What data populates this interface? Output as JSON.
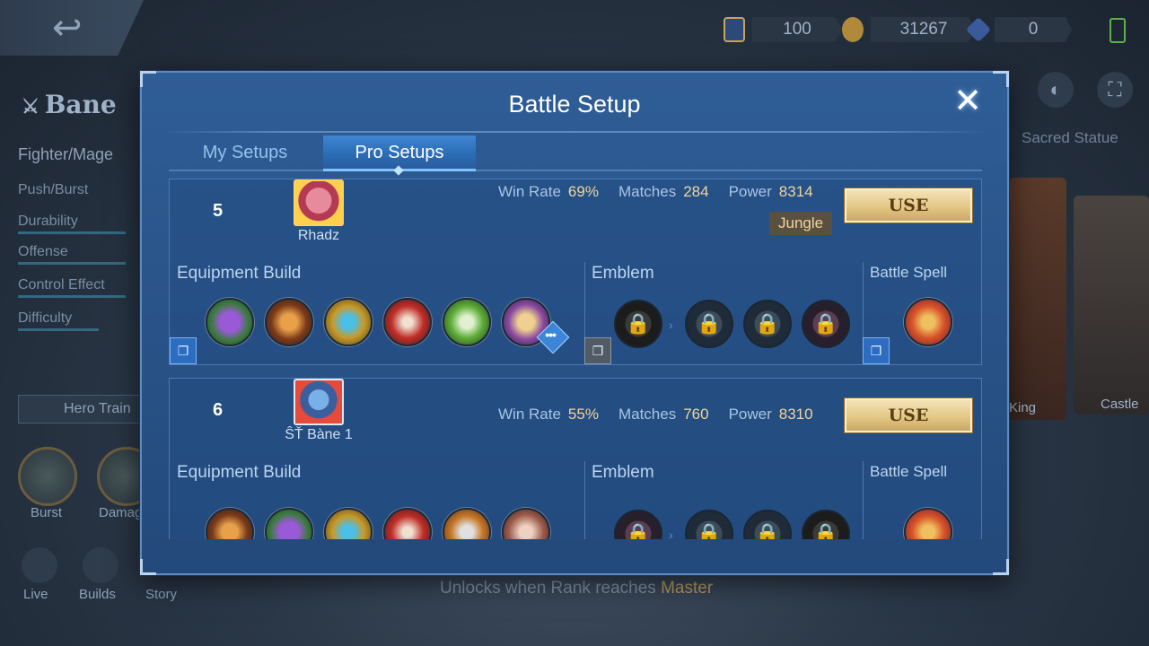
{
  "background": {
    "hero_name": "Bane",
    "role": "Fighter/Mage",
    "stats": [
      "Push/Burst",
      "Durability",
      "Offense",
      "Control Effect",
      "Difficulty"
    ],
    "hero_training": "Hero Train",
    "circles": [
      "Burst",
      "Damag"
    ],
    "nav": [
      "Live",
      "Builds",
      "Story"
    ],
    "sacred_statue": "Sacred Statue",
    "card_labels": [
      "King",
      "Castle"
    ],
    "unlock_text": "Unlocks when Rank reaches",
    "unlock_rank": "Master",
    "currency": {
      "tickets": "100",
      "gold": "31267",
      "diamonds": "0",
      "plus": "+"
    }
  },
  "modal": {
    "title": "Battle Setup",
    "close": "✕",
    "tabs": {
      "my": "My Setups",
      "pro": "Pro Setups"
    },
    "labels": {
      "win_rate": "Win Rate",
      "matches": "Matches",
      "power": "Power",
      "equipment": "Equipment Build",
      "emblem": "Emblem",
      "spell": "Battle Spell",
      "use": "USE"
    },
    "setups": [
      {
        "rank": "5",
        "player": "Rhadz",
        "win_rate": "69%",
        "matches": "284",
        "power": "8314",
        "role": "Jungle",
        "items": [
          "#7a3ab8",
          "#b85a2a",
          "#c89a2a",
          "#c0302a",
          "#5fae3a",
          "#a86a3a"
        ],
        "emblems": [
          "dark",
          "normal",
          "normal",
          "red"
        ],
        "spell_color": "#d8542a"
      },
      {
        "rank": "6",
        "player": "ŜŤ  Bàne 1",
        "win_rate": "55%",
        "matches": "760",
        "power": "8310",
        "role": "",
        "items": [
          "#b85a2a",
          "#7a3ab8",
          "#c89a2a",
          "#c0302a",
          "#c8782a",
          "#9a5a4a"
        ],
        "emblems": [
          "red",
          "normal",
          "normal",
          "dark"
        ],
        "spell_color": "#d8542a"
      }
    ]
  },
  "colors": {
    "accent_gold": "#f0d59a",
    "modal_blue": "#2a558b"
  }
}
